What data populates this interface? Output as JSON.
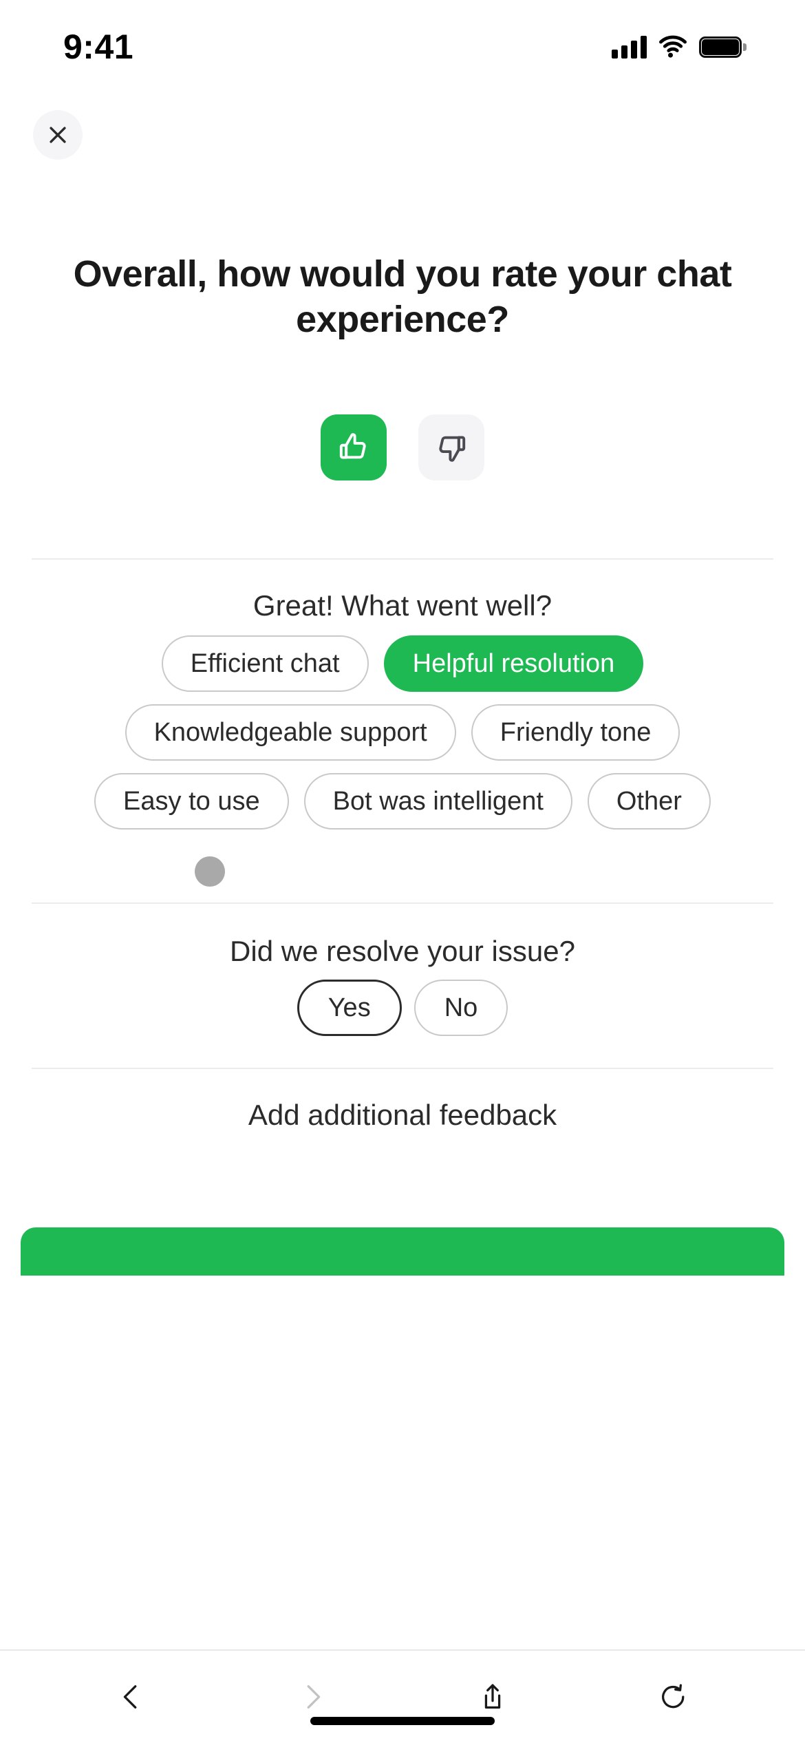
{
  "status_bar": {
    "time": "9:41",
    "signal_icon": "cellular-signal-icon",
    "wifi_icon": "wifi-icon",
    "battery_icon": "battery-full-icon"
  },
  "header": {
    "close_icon": "close-icon",
    "close_label": "Close"
  },
  "survey": {
    "title": "Overall, how would you rate your chat experience?",
    "rating": {
      "thumbs_up_icon": "thumbs-up-icon",
      "thumbs_down_icon": "thumbs-down-icon",
      "selected": "thumbs_up"
    },
    "positive_section": {
      "question": "Great! What went well?",
      "chips": [
        {
          "label": "Efficient chat",
          "selected": false
        },
        {
          "label": "Helpful resolution",
          "selected": true
        },
        {
          "label": "Knowledgeable support",
          "selected": false
        },
        {
          "label": "Friendly tone",
          "selected": false
        },
        {
          "label": "Easy to use",
          "selected": false
        },
        {
          "label": "Bot was intelligent",
          "selected": false
        },
        {
          "label": "Other",
          "selected": false
        }
      ]
    },
    "resolve_section": {
      "question": "Did we resolve your issue?",
      "options": [
        {
          "label": "Yes",
          "focused": true
        },
        {
          "label": "No",
          "focused": false
        }
      ]
    },
    "feedback_section": {
      "question": "Add additional feedback"
    }
  },
  "browser_bar": {
    "buttons": [
      {
        "name": "back-icon",
        "label": "Back",
        "enabled": true
      },
      {
        "name": "forward-icon",
        "label": "Forward",
        "enabled": false
      },
      {
        "name": "share-icon",
        "label": "Share",
        "enabled": true
      },
      {
        "name": "reload-icon",
        "label": "Reload",
        "enabled": true
      }
    ]
  },
  "colors": {
    "accent_green": "#1fb954",
    "chip_border": "#c9c9c9",
    "text_primary": "#1a1a1a",
    "divider": "#ececec",
    "neutral_button_bg": "#f4f4f6"
  }
}
